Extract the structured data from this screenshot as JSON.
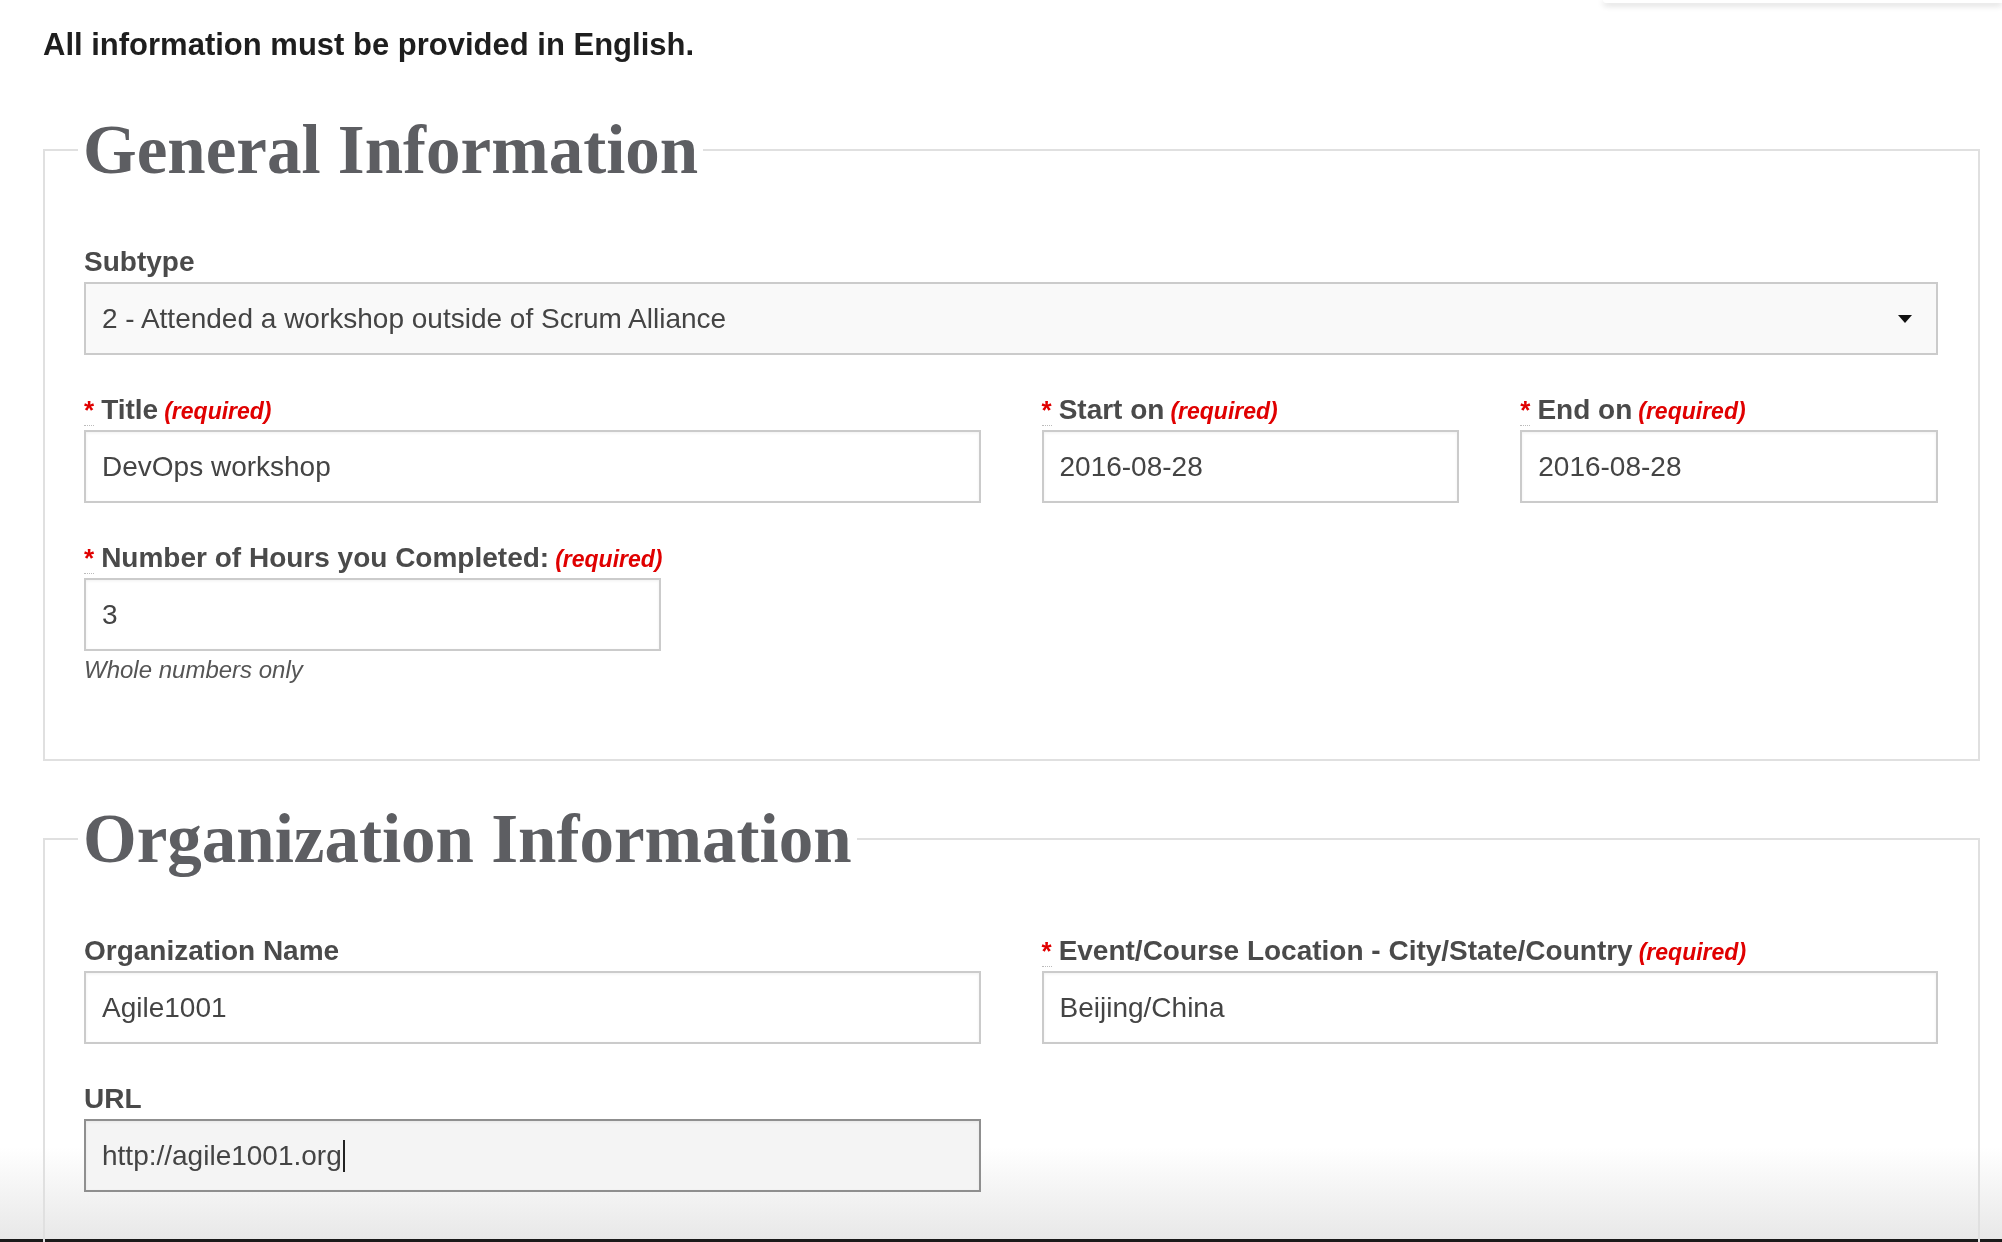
{
  "notice": "All information must be provided in English.",
  "sections": [
    {
      "title": "General Information",
      "fields": [
        {
          "kind": "select",
          "label": "Subtype",
          "value": "2 - Attended a workshop outside of Scrum Alliance",
          "focused": false
        },
        {
          "kind": "text",
          "label": "Title",
          "required_mark": "*",
          "required_note": "(required)",
          "value": "DevOps workshop",
          "focused": false
        },
        {
          "kind": "date",
          "label": "Start on",
          "required_mark": "*",
          "required_note": "(required)",
          "value": "2016-08-28",
          "focused": false
        },
        {
          "kind": "date",
          "label": "End on",
          "required_mark": "*",
          "required_note": "(required)",
          "value": "2016-08-28",
          "focused": false
        },
        {
          "kind": "number",
          "label": "Number of Hours you Completed:",
          "required_mark": "*",
          "required_note": "(required)",
          "value": "3",
          "hint": "Whole numbers only",
          "focused": false
        }
      ]
    },
    {
      "title": "Organization Information",
      "fields": [
        {
          "kind": "text",
          "label": "Organization Name",
          "value": "Agile1001",
          "focused": false
        },
        {
          "kind": "text",
          "label": "Event/Course Location - City/State/Country",
          "required_mark": "*",
          "required_note": "(required)",
          "value": "Beijing/China",
          "focused": false
        },
        {
          "kind": "url",
          "label": "URL",
          "value": "http://agile1001.org",
          "focused": true
        }
      ]
    }
  ]
}
